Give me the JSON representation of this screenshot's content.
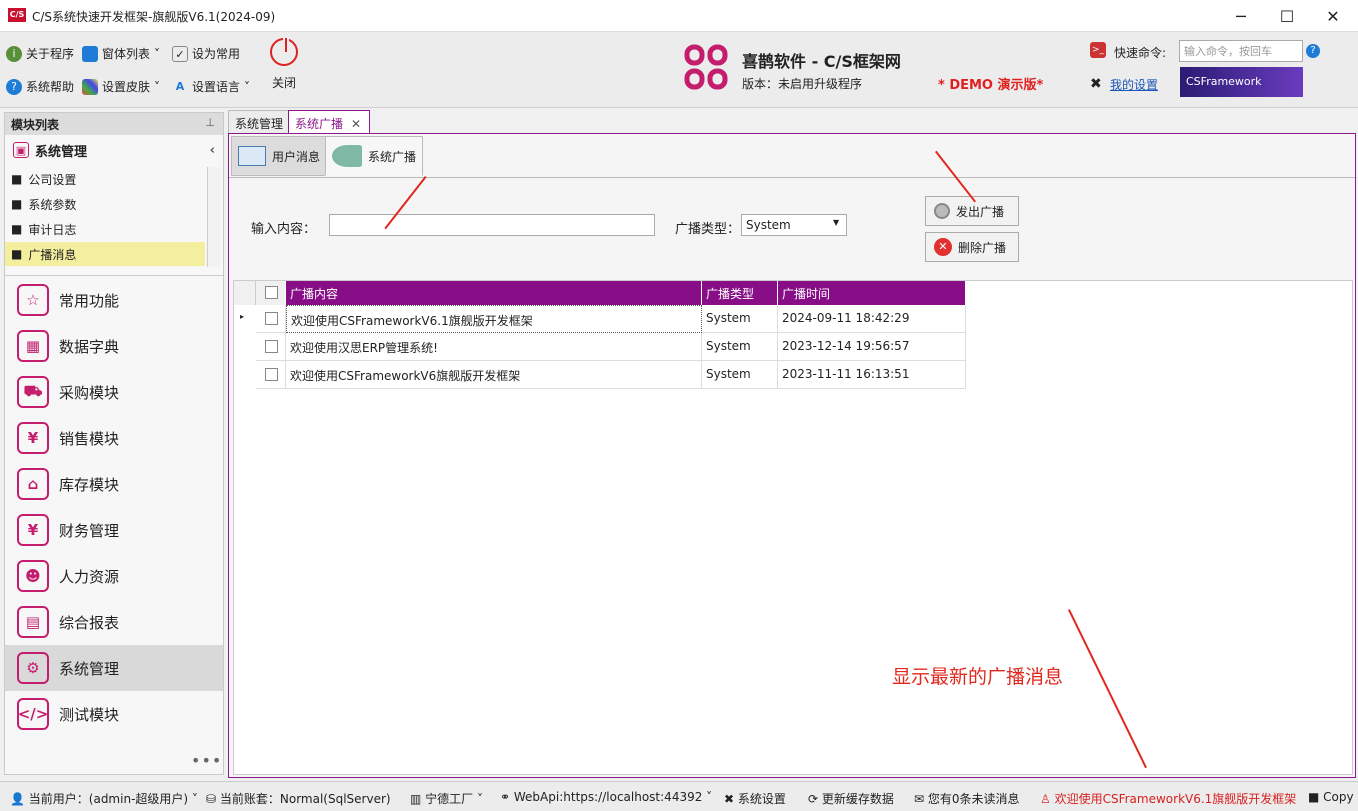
{
  "window": {
    "title": "C/S系统快速开发框架-旗舰版V6.1(2024-09)",
    "logo": "C/S"
  },
  "ribbon": {
    "about": "关于程序",
    "window_list": "窗体列表",
    "set_common": "设为常用",
    "help": "系统帮助",
    "skin": "设置皮肤",
    "language": "设置语言",
    "close": "关闭"
  },
  "brand": {
    "title": "喜鹊软件 - C/S框架网",
    "version": "版本：未启用升级程序",
    "demo": "* DEMO 演示版*",
    "banner": "CSFramework"
  },
  "quick_cmd": {
    "label": "快速命令:",
    "placeholder": "输入命令，按回车",
    "my_settings": "我的设置"
  },
  "sidebar": {
    "header": "模块列表",
    "group": "系统管理",
    "subitems": [
      "公司设置",
      "系统参数",
      "审计日志",
      "广播消息"
    ],
    "modules": [
      {
        "label": "常用功能",
        "icon": "star-icon",
        "glyph": "☆"
      },
      {
        "label": "数据字典",
        "icon": "dictionary-icon",
        "glyph": "▦"
      },
      {
        "label": "采购模块",
        "icon": "cart-icon",
        "glyph": "⛟"
      },
      {
        "label": "销售模块",
        "icon": "shopping-bag-icon",
        "glyph": "¥"
      },
      {
        "label": "库存模块",
        "icon": "warehouse-icon",
        "glyph": "⌂"
      },
      {
        "label": "财务管理",
        "icon": "finance-icon",
        "glyph": "¥"
      },
      {
        "label": "人力资源",
        "icon": "person-icon",
        "glyph": "☻"
      },
      {
        "label": "综合报表",
        "icon": "report-icon",
        "glyph": "▤"
      },
      {
        "label": "系统管理",
        "icon": "system-icon",
        "glyph": "⚙"
      },
      {
        "label": "测试模块",
        "icon": "code-icon",
        "glyph": "</>"
      }
    ]
  },
  "tabs": [
    {
      "label": "系统管理"
    },
    {
      "label": "系统广播"
    }
  ],
  "subtabs": [
    {
      "label": "用户消息"
    },
    {
      "label": "系统广播"
    }
  ],
  "form": {
    "input_label": "输入内容：",
    "type_label": "广播类型：",
    "type_value": "System",
    "send": "发出广播",
    "delete": "删除广播"
  },
  "grid": {
    "headers": [
      "广播内容",
      "广播类型",
      "广播时间"
    ],
    "rows": [
      [
        "欢迎使用CSFrameworkV6.1旗舰版开发框架",
        "System",
        "2024-09-11 18:42:29"
      ],
      [
        "欢迎使用汉思ERP管理系统!",
        "System",
        "2023-12-14 19:56:57"
      ],
      [
        "欢迎使用CSFrameworkV6旗舰版开发框架",
        "System",
        "2023-11-11 16:13:51"
      ]
    ]
  },
  "annotation": "显示最新的广播消息",
  "status": {
    "user": "当前用户：(admin-超级用户)",
    "account": "当前账套：Normal(SqlServer)",
    "factory": "宁德工厂",
    "webapi": "WebApi:https://localhost:44392",
    "settings": "系统设置",
    "refresh": "更新缓存数据",
    "unread": "您有0条未读消息",
    "broadcast": "欢迎使用CSFrameworkV6.1旗舰版开发框架",
    "copy": "Copy"
  },
  "colors": {
    "accent": "#870e87",
    "brand": "#c51d6e",
    "alert": "#e0281e"
  }
}
